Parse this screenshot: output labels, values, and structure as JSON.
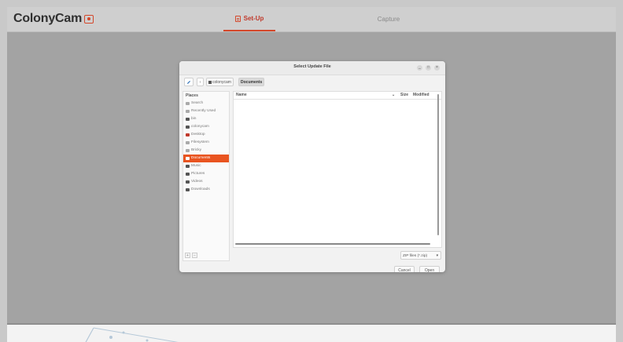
{
  "app": {
    "logo_text": "ColonyCam",
    "logo_icon": "camera-icon",
    "accent": "#d4472a"
  },
  "tabs": [
    {
      "label": "Set-Up",
      "icon": "clipboard-icon",
      "active": true
    },
    {
      "label": "Capture",
      "active": false
    }
  ],
  "dialog": {
    "title": "Select Update File",
    "window_buttons": [
      "_",
      "□",
      "×"
    ],
    "path": {
      "edit_icon": "pencil-icon",
      "back": "‹",
      "crumbs": [
        {
          "label": "colonycam",
          "icon": "home-icon",
          "active": false
        },
        {
          "label": "Documents",
          "active": true
        }
      ]
    },
    "places": {
      "header": "Places",
      "items": [
        {
          "label": "Search",
          "icon": "search-icon"
        },
        {
          "label": "Recently Used",
          "icon": "clock-icon"
        },
        {
          "label": "bin",
          "icon": "folder-icon"
        },
        {
          "label": "colonycam",
          "icon": "home-icon"
        },
        {
          "label": "Desktop",
          "icon": "desktop-icon"
        },
        {
          "label": "Filesystem",
          "icon": "drive-icon"
        },
        {
          "label": "Bricky",
          "icon": "drive-icon"
        },
        {
          "label": "Documents",
          "icon": "folder-icon",
          "selected": true
        },
        {
          "label": "Music",
          "icon": "folder-icon"
        },
        {
          "label": "Pictures",
          "icon": "folder-icon"
        },
        {
          "label": "Videos",
          "icon": "folder-icon"
        },
        {
          "label": "Downloads",
          "icon": "folder-icon"
        }
      ],
      "add": "+",
      "remove": "−"
    },
    "columns": {
      "name": "Name",
      "sort_arrow": "⌄",
      "size": "Size",
      "modified": "Modified"
    },
    "filter": {
      "value": "ZIP files (*.zip)"
    },
    "cancel_label": "Cancel",
    "open_label": "Open"
  }
}
